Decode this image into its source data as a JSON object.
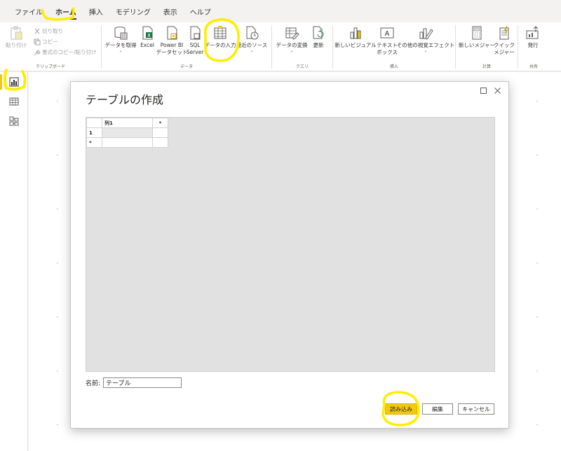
{
  "tabs": [
    "ファイル",
    "ホーム",
    "挿入",
    "モデリング",
    "表示",
    "ヘルプ"
  ],
  "active_tab": "ホーム",
  "ribbon": {
    "clipboard": {
      "label": "クリップボード",
      "paste": "貼り付け",
      "cut": "切り取り",
      "copy": "コピー",
      "format_painter": "書式のコピー/貼り付け"
    },
    "data": {
      "label": "データ",
      "get_data": "データを取得",
      "excel": "Excel",
      "powerbi_line1": "Power BI",
      "powerbi_line2": "データセット",
      "sql_line1": "SQL",
      "sql_line2": "Server",
      "enter_data": "データの入力",
      "recent_sources": "最近のソース"
    },
    "query": {
      "label": "クエリ",
      "transform": "データの変換",
      "refresh": "更新"
    },
    "insert": {
      "label": "挿入",
      "new_visual": "新しいビジュアル",
      "text_box_line1": "テキスト",
      "text_box_line2": "ボックス",
      "more_visuals": "その他の視覚エフェクト"
    },
    "calc": {
      "label": "計算",
      "new_measure": "新しいメジャー",
      "quick_measure_line1": "クイック",
      "quick_measure_line2": "メジャー"
    },
    "share": {
      "label": "共有",
      "publish": "発行"
    }
  },
  "dialog": {
    "title": "テーブルの作成",
    "table": {
      "column_header": "列1",
      "add_symbol": "*",
      "row_number": "1",
      "new_row_symbol": "*"
    },
    "name_label": "名前:",
    "name_value": "テーブル",
    "buttons": {
      "load": "読み込み",
      "edit": "編集",
      "cancel": "キャンセル"
    }
  },
  "colors": {
    "accent": "#f2c811",
    "highlight": "#ffee00"
  }
}
